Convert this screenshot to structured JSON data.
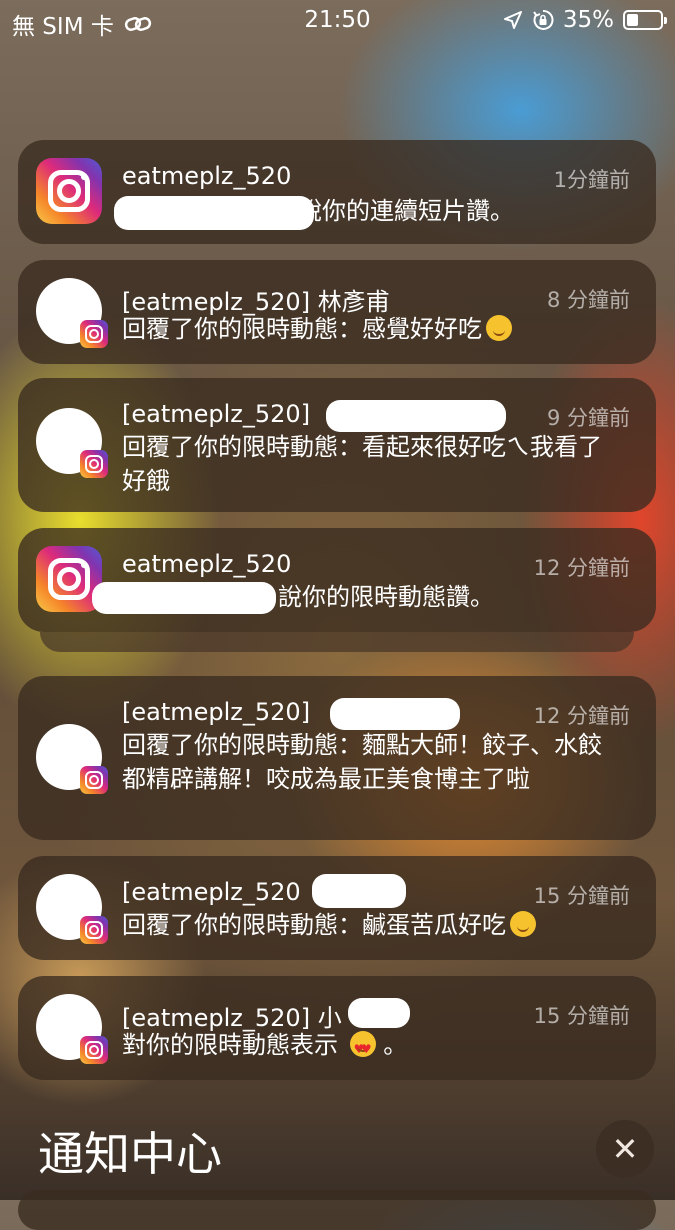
{
  "status_bar": {
    "carrier": "無 SIM 卡",
    "time": "21:50",
    "battery_percent": "35%",
    "battery_level": 0.35,
    "icons": [
      "link-icon",
      "location-arrow-icon",
      "orientation-lock-icon",
      "battery-icon"
    ]
  },
  "notifications": [
    {
      "title": "eatmeplz_520",
      "time": "1分鐘前",
      "body": "說你的連續短片讚。",
      "icon": "instagram-app-icon"
    },
    {
      "title": "[eatmeplz_520] 林彥甫",
      "time": "8 分鐘前",
      "body": "回覆了你的限時動態：感覺好好吃",
      "emoji": "drooling-face",
      "icon": "avatar"
    },
    {
      "title": "[eatmeplz_520]",
      "time": "9 分鐘前",
      "body": "回覆了你的限時動態：看起來很好吃ㄟ我看了好餓",
      "icon": "avatar"
    },
    {
      "title": "eatmeplz_520",
      "time": "12 分鐘前",
      "body": "說你的限時動態讚。",
      "icon": "instagram-app-icon"
    },
    {
      "title": "[eatmeplz_520]",
      "time": "12 分鐘前",
      "body": "回覆了你的限時動態：麵點大師！餃子、水餃都精辟講解！咬成為最正美食博主了啦",
      "icon": "avatar"
    },
    {
      "title": "[eatmeplz_520",
      "time": "15 分鐘前",
      "body": "回覆了你的限時動態：鹹蛋苦瓜好吃",
      "emoji": "yum-face",
      "icon": "avatar"
    },
    {
      "title": "[eatmeplz_520] 小",
      "time": "15 分鐘前",
      "body": "對你的限時動態表示",
      "body_tail": "。",
      "emoji": "heart-eyes-face",
      "icon": "avatar"
    }
  ],
  "footer": {
    "title": "通知中心",
    "clear_label": "✕"
  }
}
